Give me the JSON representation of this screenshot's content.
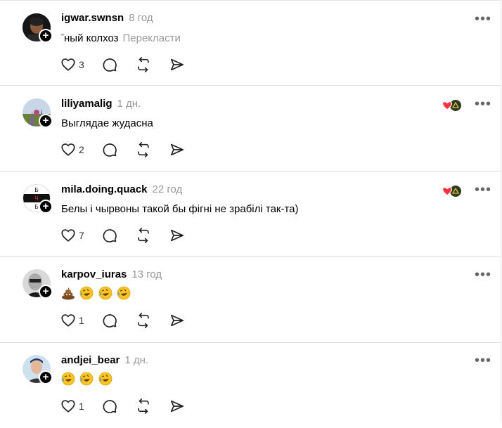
{
  "posts": [
    {
      "username": "igwar.swnsn",
      "time": "8 год",
      "text": "ный колхоз",
      "translate": "Перекласти",
      "likes": "3"
    },
    {
      "username": "liliyamalig",
      "time": "1 дн.",
      "text": "Выглядае жудасна",
      "likes": "2"
    },
    {
      "username": "mila.doing.quack",
      "time": "22 год",
      "text": "Белы і чырвоны такой бы фігні не зрабілі так-та)",
      "likes": "7"
    },
    {
      "username": "karpov_iuras",
      "time": "13 год",
      "emojis": [
        "pile-of-poo",
        "rolling-on-floor-laughing",
        "rolling-on-floor-laughing",
        "rolling-on-floor-laughing"
      ],
      "likes": "1"
    },
    {
      "username": "andjei_bear",
      "time": "1 дн.",
      "emojis": [
        "rolling-on-floor-laughing",
        "rolling-on-floor-laughing",
        "rolling-on-floor-laughing"
      ],
      "likes": "1"
    }
  ],
  "avatar3_letters": [
    "Б",
    "Ч",
    "Б"
  ],
  "more_label": "•••",
  "plus_label": "+",
  "colors": {
    "like_heart": "#ff3040",
    "emoji_yellow": "#f7c325",
    "poo_brown": "#8b5a2b",
    "time_gray": "#999999"
  }
}
